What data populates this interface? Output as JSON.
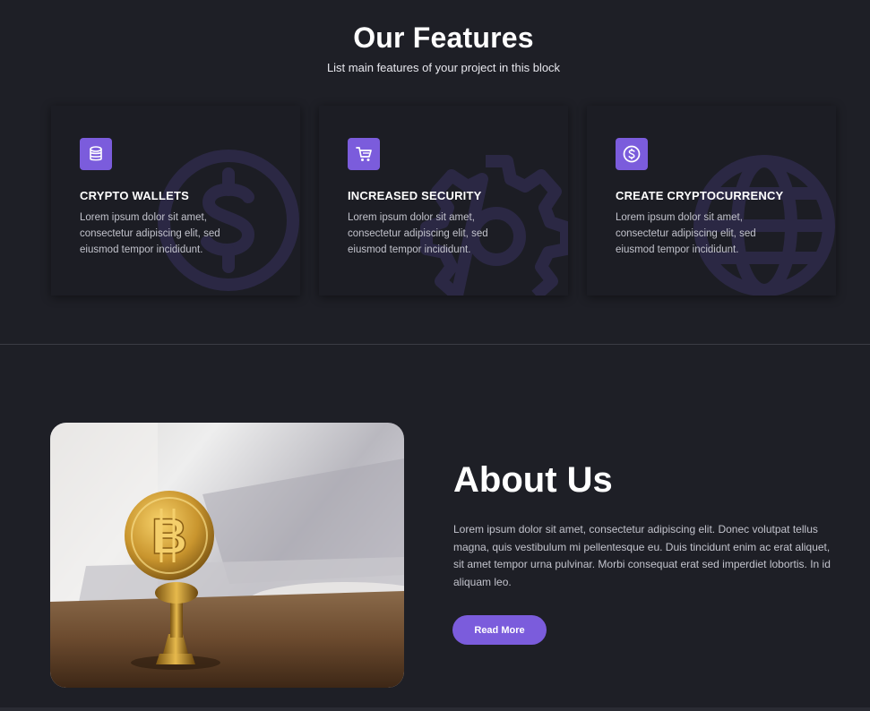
{
  "features": {
    "title": "Our Features",
    "subtitle": "List main features of your project in this block",
    "cards": [
      {
        "icon": "database-icon",
        "background_icon": "dollar-circle-icon",
        "title": "CRYPTO WALLETS",
        "text": "Lorem ipsum dolor sit amet, consectetur adipiscing elit, sed eiusmod tempor incididunt."
      },
      {
        "icon": "cart-icon",
        "background_icon": "gear-icon",
        "title": "INCREASED SECURITY",
        "text": "Lorem ipsum dolor sit amet, consectetur adipiscing elit, sed eiusmod tempor incididunt."
      },
      {
        "icon": "dollar-circle-icon",
        "background_icon": "globe-icon",
        "title": "CREATE CRYPTOCURRENCY",
        "text": "Lorem ipsum dolor sit amet, consectetur adipiscing elit, sed eiusmod tempor incididunt."
      }
    ]
  },
  "about": {
    "title": "About Us",
    "text": "Lorem ipsum dolor sit amet, consectetur adipiscing elit. Donec volutpat tellus magna, quis vestibulum mi pellentesque eu. Duis tincidunt enim ac erat aliquet, sit amet tempor urna pulvinar. Morbi consequat erat sed imperdiet lobortis. In id aliquam leo.",
    "button_label": "Read More",
    "image": "bitcoin-coin-photo"
  },
  "colors": {
    "background": "#1e1f26",
    "card": "#1c1d24",
    "accent": "#7b5cdc",
    "watermark": "#2b2844"
  }
}
